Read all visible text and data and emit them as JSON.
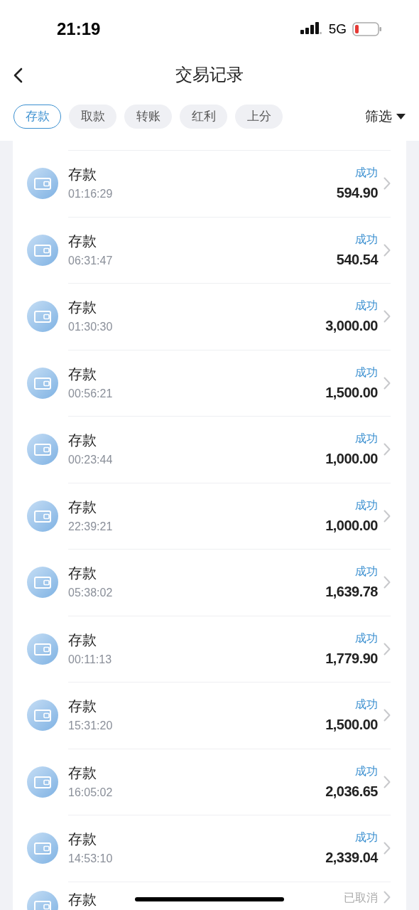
{
  "status_bar": {
    "time": "21:19",
    "network": "5G"
  },
  "header": {
    "title": "交易记录"
  },
  "tabs": [
    {
      "label": "存款",
      "selected": true
    },
    {
      "label": "取款",
      "selected": false
    },
    {
      "label": "转账",
      "selected": false
    },
    {
      "label": "红利",
      "selected": false
    },
    {
      "label": "上分",
      "selected": false
    }
  ],
  "filter": {
    "label": "筛选"
  },
  "records": [
    {
      "name": "存款",
      "time": "01:16:29",
      "status": "成功",
      "cancelled": false,
      "amount": "594.90"
    },
    {
      "name": "存款",
      "time": "06:31:47",
      "status": "成功",
      "cancelled": false,
      "amount": "540.54"
    },
    {
      "name": "存款",
      "time": "01:30:30",
      "status": "成功",
      "cancelled": false,
      "amount": "3,000.00"
    },
    {
      "name": "存款",
      "time": "00:56:21",
      "status": "成功",
      "cancelled": false,
      "amount": "1,500.00"
    },
    {
      "name": "存款",
      "time": "00:23:44",
      "status": "成功",
      "cancelled": false,
      "amount": "1,000.00"
    },
    {
      "name": "存款",
      "time": "22:39:21",
      "status": "成功",
      "cancelled": false,
      "amount": "1,000.00"
    },
    {
      "name": "存款",
      "time": "05:38:02",
      "status": "成功",
      "cancelled": false,
      "amount": "1,639.78"
    },
    {
      "name": "存款",
      "time": "00:11:13",
      "status": "成功",
      "cancelled": false,
      "amount": "1,779.90"
    },
    {
      "name": "存款",
      "time": "15:31:20",
      "status": "成功",
      "cancelled": false,
      "amount": "1,500.00"
    },
    {
      "name": "存款",
      "time": "16:05:02",
      "status": "成功",
      "cancelled": false,
      "amount": "2,036.65"
    },
    {
      "name": "存款",
      "time": "14:53:10",
      "status": "成功",
      "cancelled": false,
      "amount": "2,339.04"
    },
    {
      "name": "存款",
      "status": "已取消",
      "cancelled": true
    }
  ]
}
